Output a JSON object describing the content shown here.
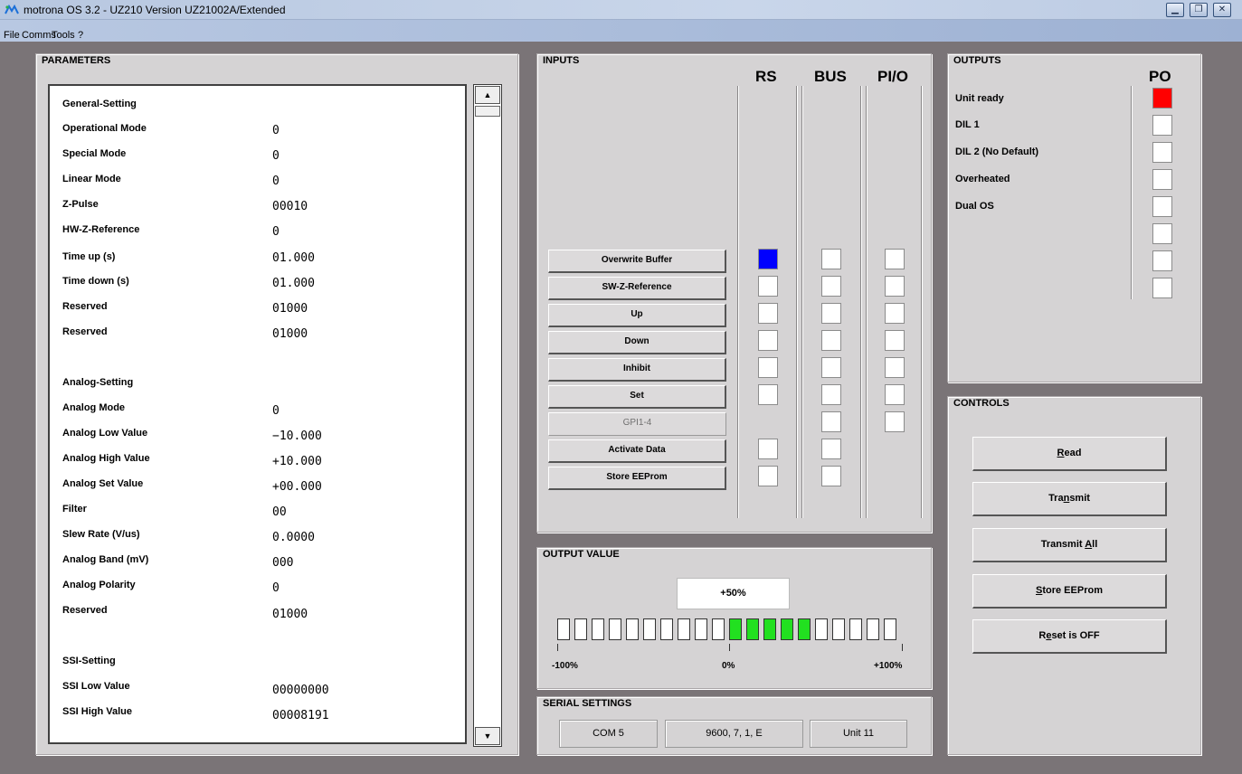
{
  "window": {
    "title": "motrona OS 3.2  -  UZ210 Version UZ21002A/Extended",
    "buttons": [
      "minimize-icon",
      "restore-icon",
      "close-icon"
    ]
  },
  "menu": {
    "items": [
      "File",
      "Comms",
      "Tools",
      "?"
    ]
  },
  "parameters": {
    "title": "PARAMETERS",
    "rows": [
      {
        "label": "General-Setting",
        "value": ""
      },
      {
        "label": "Operational Mode",
        "value": "0"
      },
      {
        "label": "Special Mode",
        "value": "0"
      },
      {
        "label": "Linear Mode",
        "value": "0"
      },
      {
        "label": "Z-Pulse",
        "value": "00010"
      },
      {
        "label": "HW-Z-Reference",
        "value": "0"
      },
      {
        "label": "Time up (s)",
        "value": "01.000"
      },
      {
        "label": "Time down (s)",
        "value": "01.000"
      },
      {
        "label": "Reserved",
        "value": "01000"
      },
      {
        "label": "Reserved",
        "value": "01000"
      },
      {
        "label": "Analog-Setting",
        "value": ""
      },
      {
        "label": "Analog Mode",
        "value": "0"
      },
      {
        "label": "Analog Low Value",
        "value": "−10.000"
      },
      {
        "label": "Analog High Value",
        "value": "+10.000"
      },
      {
        "label": "Analog Set Value",
        "value": "+00.000"
      },
      {
        "label": "Filter",
        "value": "00"
      },
      {
        "label": "Slew Rate (V/us)",
        "value": "0.0000"
      },
      {
        "label": "Analog Band (mV)",
        "value": "000"
      },
      {
        "label": "Analog Polarity",
        "value": "0"
      },
      {
        "label": "Reserved",
        "value": "01000"
      },
      {
        "label": "SSI-Setting",
        "value": ""
      },
      {
        "label": "SSI Low Value",
        "value": "00000000"
      },
      {
        "label": "SSI High Value",
        "value": "00008191"
      }
    ]
  },
  "inputs": {
    "title": "INPUTS",
    "columns": [
      "RS",
      "BUS",
      "PI/O"
    ],
    "buttons": [
      {
        "label": "Overwrite Buffer",
        "enabled": true,
        "rs": "checked",
        "bus": "unchecked",
        "pio": "unchecked"
      },
      {
        "label": "SW-Z-Reference",
        "enabled": true,
        "rs": "unchecked",
        "bus": "unchecked",
        "pio": "unchecked"
      },
      {
        "label": "Up",
        "enabled": true,
        "rs": "unchecked",
        "bus": "unchecked",
        "pio": "unchecked"
      },
      {
        "label": "Down",
        "enabled": true,
        "rs": "unchecked",
        "bus": "unchecked",
        "pio": "unchecked"
      },
      {
        "label": "Inhibit",
        "enabled": true,
        "rs": "unchecked",
        "bus": "unchecked",
        "pio": "unchecked"
      },
      {
        "label": "Set",
        "enabled": true,
        "rs": "unchecked",
        "bus": "unchecked",
        "pio": "unchecked"
      },
      {
        "label": "GPI1-4",
        "enabled": false,
        "rs": "none",
        "bus": "unchecked",
        "pio": "unchecked"
      },
      {
        "label": "Activate Data",
        "enabled": true,
        "rs": "unchecked",
        "bus": "unchecked",
        "pio": "none"
      },
      {
        "label": "Store EEProm",
        "enabled": true,
        "rs": "unchecked",
        "bus": "unchecked",
        "pio": "none"
      }
    ],
    "checked_color": "#0000ff"
  },
  "outputs": {
    "title": "OUTPUTS",
    "column": "PO",
    "labels": [
      "Unit ready",
      "DIL 1",
      "DIL 2 (No Default)",
      "Overheated",
      "Dual OS"
    ],
    "active": [
      true,
      false,
      false,
      false,
      false,
      false,
      false,
      false
    ],
    "active_color": "#ff0000"
  },
  "controls": {
    "title": "CONTROLS",
    "buttons": [
      {
        "pre": "",
        "acc": "R",
        "post": "ead"
      },
      {
        "pre": "Tra",
        "acc": "n",
        "post": "smit"
      },
      {
        "pre": "Transmit ",
        "acc": "A",
        "post": "ll"
      },
      {
        "pre": "",
        "acc": "S",
        "post": "tore EEProm"
      },
      {
        "pre": "R",
        "acc": "e",
        "post": "set is OFF"
      }
    ]
  },
  "output_value": {
    "title": "OUTPUT VALUE",
    "value_text": "+50%",
    "value_percent": 50,
    "segments": 20,
    "scale": [
      "-100%",
      "0%",
      "+100%"
    ],
    "bar_color": "#22e020"
  },
  "serial": {
    "title": "SERIAL SETTINGS",
    "port": "COM 5",
    "params": "9600, 7, 1, E",
    "unit": "Unit 11"
  }
}
